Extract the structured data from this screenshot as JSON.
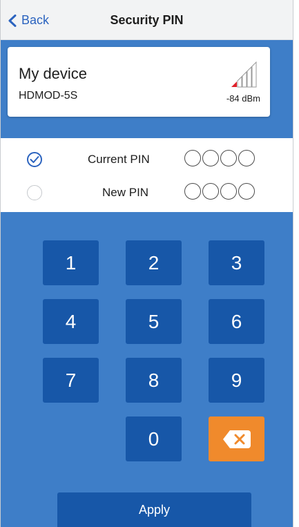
{
  "header": {
    "back_label": "Back",
    "title": "Security PIN"
  },
  "device": {
    "name": "My device",
    "id": "HDMOD-5S",
    "signal": "-84 dBm"
  },
  "pin_rows": [
    {
      "label": "Current PIN",
      "selected": true
    },
    {
      "label": "New PIN",
      "selected": false
    }
  ],
  "keypad": {
    "keys": [
      "1",
      "2",
      "3",
      "4",
      "5",
      "6",
      "7",
      "8",
      "9",
      "0"
    ],
    "backspace_icon": "backspace-icon"
  },
  "apply_label": "Apply",
  "colors": {
    "accent_blue": "#3e7ec8",
    "key_blue": "#1757a8",
    "link_blue": "#2b63bf",
    "backspace_orange": "#f08a2c",
    "signal_red": "#e0202a"
  }
}
